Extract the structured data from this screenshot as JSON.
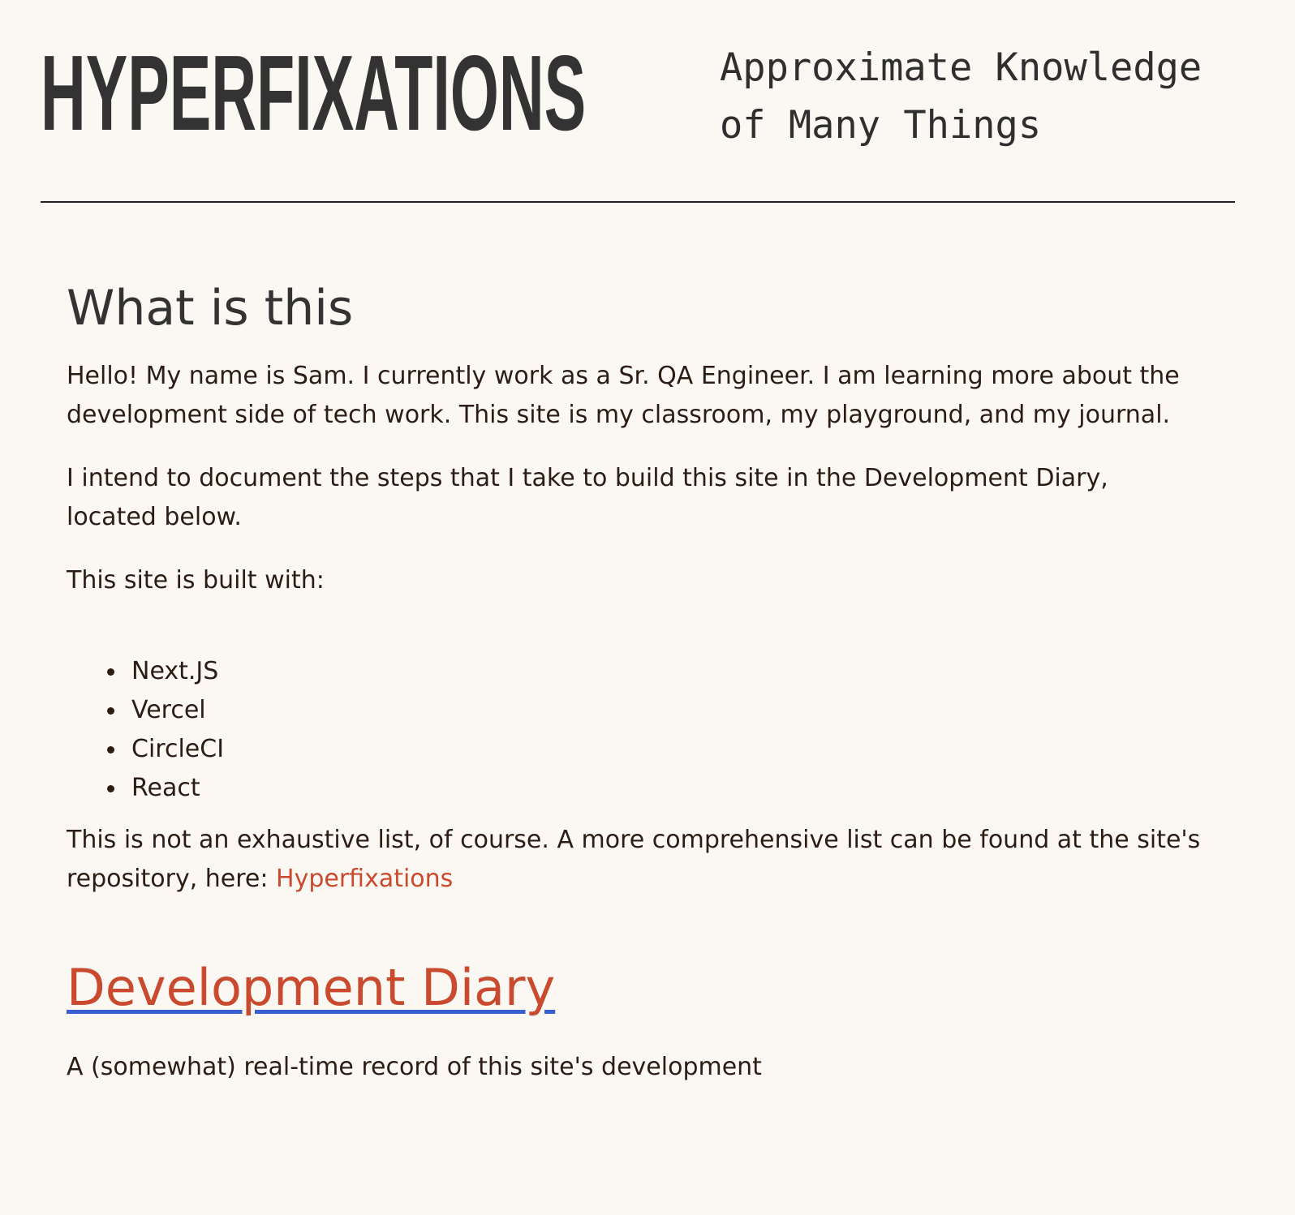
{
  "header": {
    "title": "HYPERFIXATIONS",
    "tagline_line1": "Approximate Knowledge",
    "tagline_line2": "of Many Things"
  },
  "intro": {
    "heading": "What is this",
    "paragraph1": "Hello! My name is Sam. I currently work as a Sr. QA Engineer. I am learning more about the development side of tech work. This site is my classroom, my playground, and my journal.",
    "paragraph2": "I intend to document the steps that I take to build this site in the Development Diary, located below.",
    "paragraph3": "This site is built with:",
    "tech_list": [
      "Next.JS",
      "Vercel",
      "CircleCI",
      "React"
    ],
    "paragraph4_prefix": "This is not an exhaustive list, of course. A more comprehensive list can be found at the site's repository, here: ",
    "repo_link_label": "Hyperfixations"
  },
  "diary": {
    "heading": "Development Diary",
    "description": "A (somewhat) real-time record of this site's development"
  },
  "colors": {
    "background": "#fbf8f3",
    "link": "#c94a2e",
    "underline": "#3a5fd0",
    "text": "#2b1d14"
  }
}
